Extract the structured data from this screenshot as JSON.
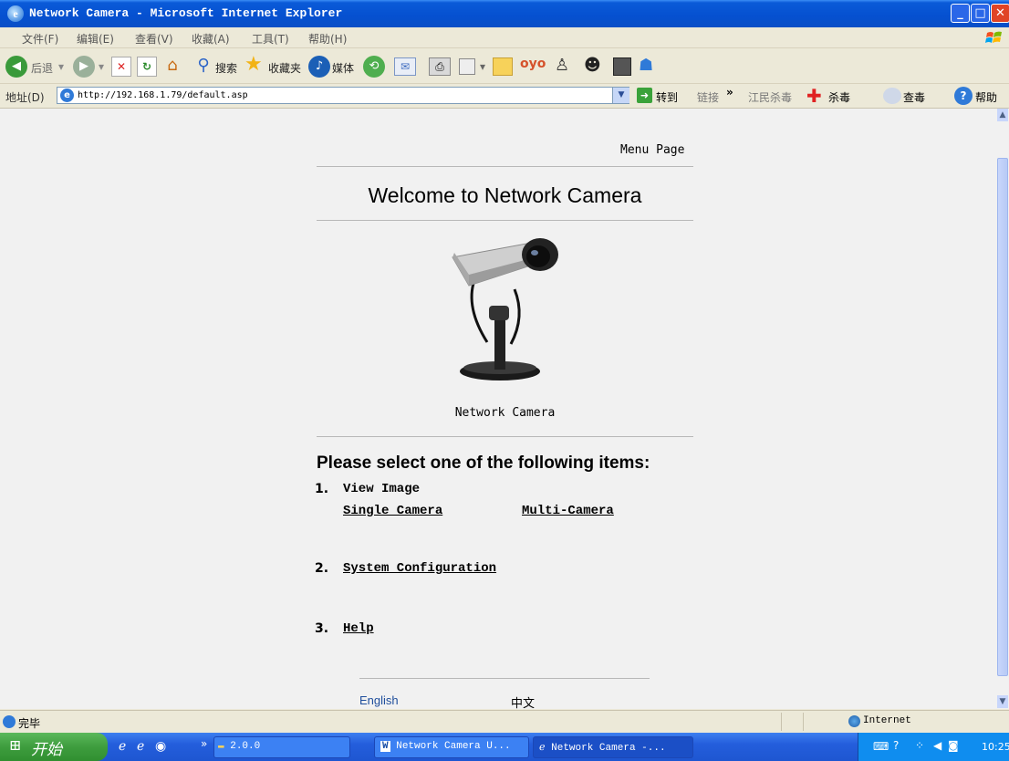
{
  "window": {
    "title": "Network Camera - Microsoft Internet Explorer"
  },
  "menubar": {
    "items": [
      "文件(F)",
      "编辑(E)",
      "查看(V)",
      "收藏(A)",
      "工具(T)",
      "帮助(H)"
    ]
  },
  "toolbar": {
    "back": "后退",
    "search": "搜索",
    "favorites": "收藏夹",
    "media": "媒体"
  },
  "address": {
    "label": "地址(D)",
    "url": "http://192.168.1.79/default.asp",
    "go": "转到",
    "links": "链接",
    "plugin1": "江民杀毒",
    "plugin2": "杀毒",
    "plugin3": "查毒",
    "help": "帮助"
  },
  "page": {
    "menu_page": "Menu Page",
    "heading": "Welcome to Network Camera",
    "image_caption": "Network Camera",
    "select_prompt": "Please select one of the following items:",
    "items": [
      {
        "num": "1.",
        "label": "View Image",
        "links": [
          "Single Camera",
          "Multi-Camera"
        ]
      },
      {
        "num": "2.",
        "label": "System Configuration"
      },
      {
        "num": "3.",
        "label": "Help"
      }
    ],
    "lang_english": "English",
    "lang_chinese": "中文"
  },
  "status": {
    "text": "完毕",
    "zone": "Internet"
  },
  "taskbar": {
    "start": "开始",
    "folder": "2.0.0",
    "task1": "Network Camera U...",
    "task2": "Network Camera -...",
    "clock": "10:25"
  },
  "colors": {
    "link_lang": "#1F4E9C",
    "titlebar": "#0A5AD8",
    "start": "#3E9D3E"
  }
}
